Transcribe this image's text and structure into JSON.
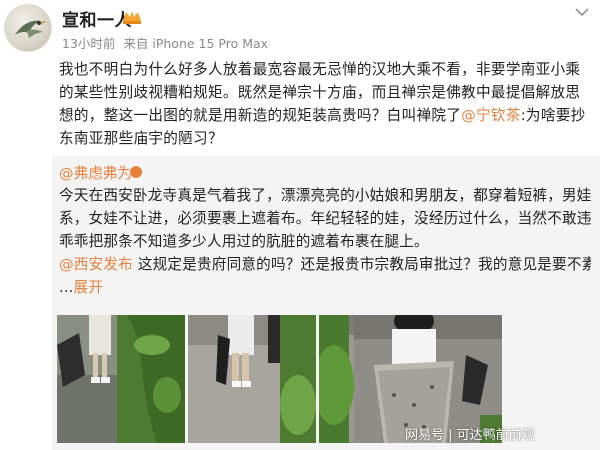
{
  "post": {
    "username": "宣和一人",
    "time": "13小时前",
    "source": "来自 iPhone 15 Pro Max",
    "text_parts": [
      "我也不明白为什么好多人放着最宽容最无忌惮的汉地大乘不看，非要学南亚小乘的某些性别歧视糟粕规矩。既然是禅宗十方庙，而且禅宗是佛教中最提倡解放思想的，整这一出图的就是用新造的规矩装高贵吗？白叫禅院了",
      "@宁钦茶",
      ":为啥要抄东南亚那些庙宇的陋习？"
    ]
  },
  "repost": {
    "author": "@弗虑弗为",
    "lines": [
      "今天在西安卧龙寺真是气着我了，漂漂亮亮的小姑娘和男朋友，都穿着短裤，男娃没关",
      "系，女娃不让进，必须要裹上遮着布。年纪轻轻的娃，没经历过什么，当然不敢违抗，",
      "乖乖把那条不知道多少人用过的肮脏的遮着布裹在腿上。"
    ],
    "line4_mention": "@西安发布",
    "line4_text": " 这规定是贵府同意的吗？还是报贵市宗教局审批过？我的意见是要不素性建",
    "line5_prefix": "...",
    "line5_link": "展开"
  },
  "watermark": "网易号 | 可达鸭前前观",
  "icons": {
    "more": "chevron-down-icon",
    "vip": "vip-badge-icon",
    "level": "user-level-icon"
  },
  "colors": {
    "mention": "#e8803a",
    "repost_bg": "#f4f4f4"
  }
}
